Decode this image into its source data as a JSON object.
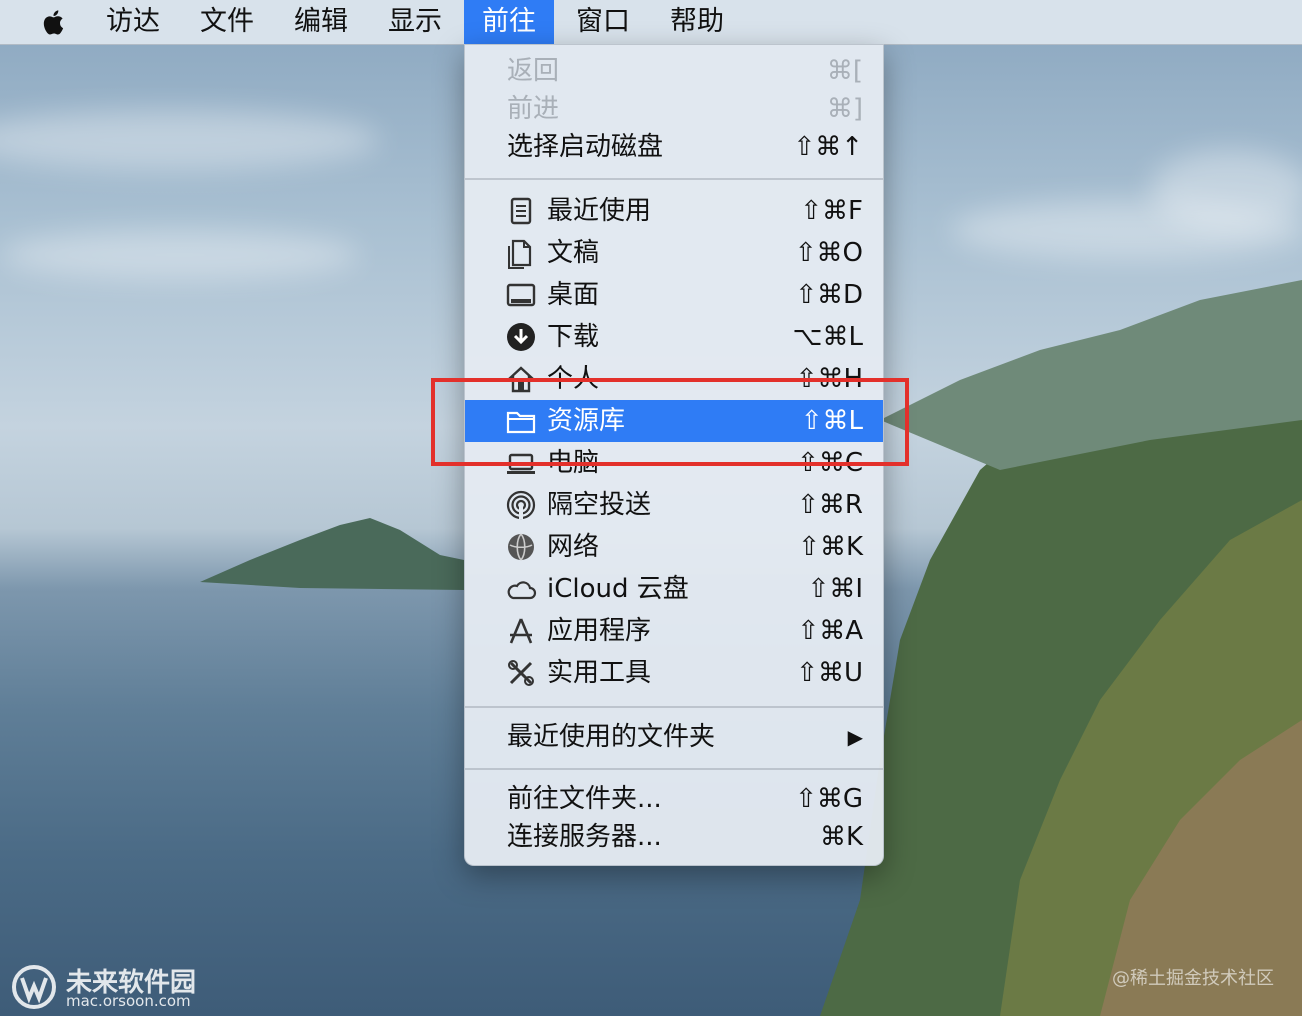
{
  "menubar": {
    "items": [
      "访达",
      "文件",
      "编辑",
      "显示",
      "前往",
      "窗口",
      "帮助"
    ],
    "active_index": 4
  },
  "go_menu": {
    "items": [
      {
        "label": "返回",
        "shortcut": "⌘[",
        "disabled": true
      },
      {
        "label": "前进",
        "shortcut": "⌘]",
        "disabled": true
      },
      {
        "label": "选择启动磁盘",
        "shortcut": "⇧⌘↑",
        "disabled": false
      },
      {
        "label": "最近使用",
        "shortcut": "⇧⌘F",
        "icon": "recents-icon"
      },
      {
        "label": "文稿",
        "shortcut": "⇧⌘O",
        "icon": "documents-icon"
      },
      {
        "label": "桌面",
        "shortcut": "⇧⌘D",
        "icon": "desktop-icon"
      },
      {
        "label": "下载",
        "shortcut": "⌥⌘L",
        "icon": "downloads-icon"
      },
      {
        "label": "个人",
        "shortcut": "⇧⌘H",
        "icon": "home-icon"
      },
      {
        "label": "资源库",
        "shortcut": "⇧⌘L",
        "icon": "folder-icon",
        "selected": true
      },
      {
        "label": "电脑",
        "shortcut": "⇧⌘C",
        "icon": "computer-icon"
      },
      {
        "label": "隔空投送",
        "shortcut": "⇧⌘R",
        "icon": "airdrop-icon"
      },
      {
        "label": "网络",
        "shortcut": "⇧⌘K",
        "icon": "network-icon"
      },
      {
        "label": "iCloud 云盘",
        "shortcut": "⇧⌘I",
        "icon": "cloud-icon"
      },
      {
        "label": "应用程序",
        "shortcut": "⇧⌘A",
        "icon": "applications-icon"
      },
      {
        "label": "实用工具",
        "shortcut": "⇧⌘U",
        "icon": "utilities-icon"
      },
      {
        "label": "最近使用的文件夹",
        "shortcut": "▶"
      },
      {
        "label": "前往文件夹...",
        "shortcut": "⇧⌘G"
      },
      {
        "label": "连接服务器...",
        "shortcut": "⌘K"
      }
    ]
  },
  "watermarks": {
    "left_name": "未来软件园",
    "left_url": "mac.orsoon.com",
    "right": "@稀土掘金技术社区"
  },
  "colors": {
    "selection": "#2f7cf5",
    "highlight_border": "#e3302b",
    "menu_bg": "#e4eaf1"
  }
}
